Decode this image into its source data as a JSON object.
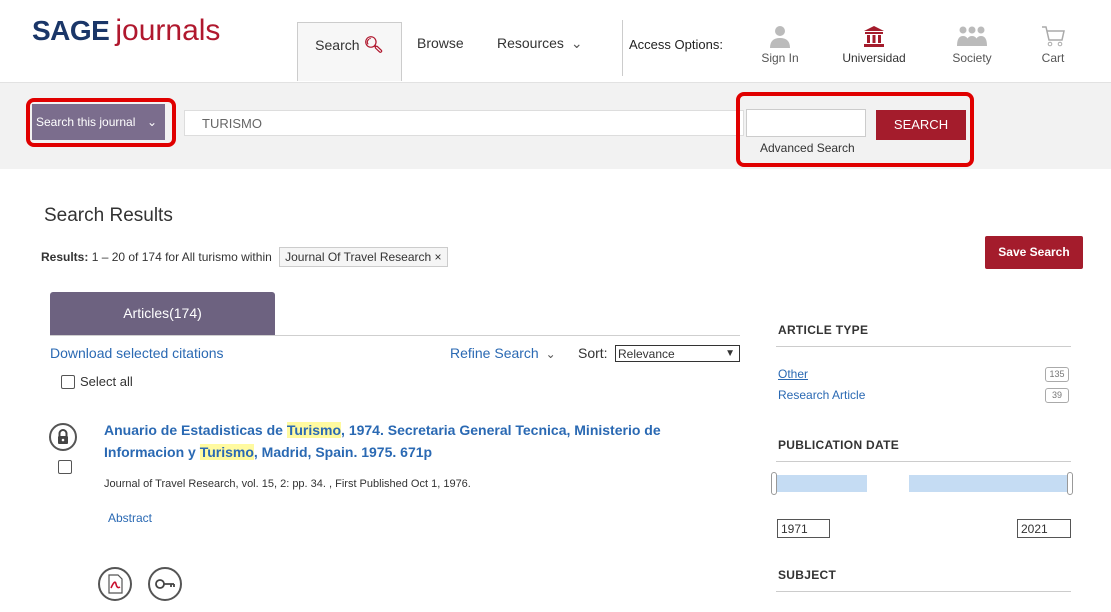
{
  "header": {
    "logo_brand": "SAGE",
    "logo_product": "journals",
    "nav": {
      "search_label": "Search",
      "browse_label": "Browse",
      "resources_label": "Resources"
    },
    "access_options_label": "Access Options:",
    "icons": [
      {
        "label": "Sign In",
        "icon": "person-icon"
      },
      {
        "label": "Universidad",
        "icon": "institution-icon"
      },
      {
        "label": "Society",
        "icon": "society-icon"
      },
      {
        "label": "Cart",
        "icon": "cart-icon"
      }
    ]
  },
  "search": {
    "scope_label": "Search this journal",
    "query_value": "TURISMO",
    "button_label": "SEARCH",
    "advanced_label": "Advanced Search"
  },
  "results": {
    "title": "Search Results",
    "summary_label": "Results:",
    "summary_text": "1 – 20 of 174 for All turismo within",
    "filter_chip": "Journal Of Travel Research",
    "save_search_label": "Save Search"
  },
  "tabs": {
    "articles_label": "Articles(174)"
  },
  "toolbar": {
    "download_label": "Download selected citations",
    "refine_label": "Refine Search",
    "sort_label": "Sort:",
    "sort_value": "Relevance",
    "select_all_label": "Select all"
  },
  "article": {
    "title_parts": [
      {
        "text": "Anuario de Estadisticas de ",
        "hl": false
      },
      {
        "text": "Turismo",
        "hl": true
      },
      {
        "text": ", 1974. Secretaria General Tecnica, Ministerio de Informacion y ",
        "hl": false
      },
      {
        "text": "Turismo",
        "hl": true
      },
      {
        "text": ", Madrid, Spain. 1975. 671p",
        "hl": false
      }
    ],
    "meta": "Journal of Travel Research, vol. 15, 2: pp. 34. , First Published Oct 1, 1976.",
    "abstract_label": "Abstract"
  },
  "facets": {
    "article_type_heading": "ARTICLE TYPE",
    "article_types": [
      {
        "label": "Other",
        "count": "135"
      },
      {
        "label": "Research Article",
        "count": "39"
      }
    ],
    "pub_date_heading": "PUBLICATION DATE",
    "year_from": "1971",
    "year_to": "2021",
    "subject_heading": "SUBJECT"
  },
  "colors": {
    "brand_red": "#a41c2c",
    "brand_navy": "#1a3668",
    "link_blue": "#2a69b3",
    "tab_purple": "#6d6280",
    "highlight_yellow": "#fffaa0",
    "annotation_red": "#e00000"
  }
}
